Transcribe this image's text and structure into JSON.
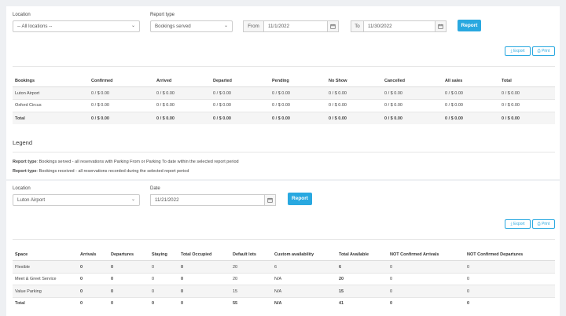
{
  "filters1": {
    "location_label": "Location",
    "location_value": "-- All locations --",
    "report_type_label": "Report type",
    "report_type_value": "Bookings served",
    "from_label": "From",
    "from_value": "11/1/2022",
    "to_label": "To",
    "to_value": "11/30/2022",
    "report_button": "Report"
  },
  "export_label": "Export",
  "print_label": "Print",
  "bookings_table": {
    "headers": [
      "Bookings",
      "Confirmed",
      "Arrived",
      "Departed",
      "Pending",
      "No Show",
      "Cancelled",
      "All sales",
      "Total"
    ],
    "rows": [
      [
        "Luton Airport",
        "0 / $ 0.00",
        "0 / $ 0.00",
        "0 / $ 0.00",
        "0 / $ 0.00",
        "0 / $ 0.00",
        "0 / $ 0.00",
        "0 / $ 0.00",
        "0 / $ 0.00"
      ],
      [
        "Oxford Circus",
        "0 / $ 0.00",
        "0 / $ 0.00",
        "0 / $ 0.00",
        "0 / $ 0.00",
        "0 / $ 0.00",
        "0 / $ 0.00",
        "0 / $ 0.00",
        "0 / $ 0.00"
      ],
      [
        "Total",
        "0 / $ 0.00",
        "0 / $ 0.00",
        "0 / $ 0.00",
        "0 / $ 0.00",
        "0 / $ 0.00",
        "0 / $ 0.00",
        "0 / $ 0.00",
        "0 / $ 0.00"
      ]
    ]
  },
  "legend": {
    "title": "Legend",
    "line1_label": "Report type",
    "line1_text": ": Bookings served - all reservations with Parking From or Parking To date within the selected report period",
    "line2_label": "Report type",
    "line2_text": ": Bookings received - all reservations recorded during the selected report period"
  },
  "filters2": {
    "location_label": "Location",
    "location_value": "Luton Airport",
    "date_label": "Date",
    "date_value": "11/21/2022",
    "report_button": "Report"
  },
  "space_table": {
    "headers": [
      "Space",
      "Arrivals",
      "Departures",
      "Staying",
      "Total Occupied",
      "Default lots",
      "Custom availability",
      "Total Available",
      "NOT Confirmed Arrivals",
      "NOT Confirmed Departures"
    ],
    "rows": [
      [
        "Flexible",
        "0",
        "0",
        "0",
        "0",
        "20",
        "6",
        "6",
        "0",
        "0"
      ],
      [
        "Meet & Greet Service",
        "0",
        "0",
        "0",
        "0",
        "20",
        "N/A",
        "20",
        "0",
        "0"
      ],
      [
        "Value Parking",
        "0",
        "0",
        "0",
        "0",
        "15",
        "N/A",
        "15",
        "0",
        "0"
      ],
      [
        "Total",
        "0",
        "0",
        "0",
        "0",
        "55",
        "N/A",
        "41",
        "0",
        "0"
      ]
    ]
  }
}
